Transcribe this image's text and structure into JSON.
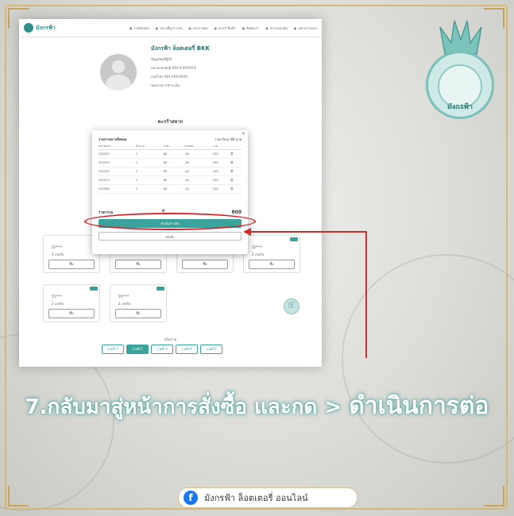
{
  "app": {
    "brand_name": "มังกรฟ้า",
    "logo_name": "มังกรฟ้า"
  },
  "nav": {
    "links": [
      "งวดปัจจุบัน",
      "สลากที่ถูกรางวัล",
      "ประกาศผล",
      "ตะกร้าสินค้า",
      "ติดต่อเรา",
      "สลากของฉัน",
      "ออกจากระบบ"
    ]
  },
  "profile": {
    "title": "มังกรฟ้า ล็อตเตอรี่ BKK",
    "lines": [
      "ข้อมูลบัญชีผู้ใช้",
      "หมายเลขบัญชี XXX-X-XXXXX-X",
      "เบอร์โทร 083-XXX-XXXX",
      "ช่องทางการชำระเงิน"
    ]
  },
  "page": {
    "section_title": "ตะกร้าสลาก",
    "pager_title": "เลือกงวด"
  },
  "modal": {
    "header": "รายการสลากทั้งหมด",
    "price_text": "ราคาใบละ 80 บาท",
    "columns": [
      "หมายเลข",
      "จำนวน",
      "ราคา",
      "ส่วนลด",
      "รวม",
      ""
    ],
    "rows": [
      [
        "255070",
        "2",
        "80",
        "-40",
        "200",
        "🗑"
      ],
      [
        "524070",
        "2",
        "80",
        "-40",
        "200",
        "🗑"
      ],
      [
        "222222",
        "2",
        "80",
        "-40",
        "200",
        "🗑"
      ],
      [
        "412573",
        "1",
        "80",
        "-20",
        "100",
        "🗑"
      ],
      [
        "412344",
        "1",
        "80",
        "-20",
        "100",
        "🗑"
      ]
    ],
    "total_label": "ราคารวม",
    "total_qty": "8",
    "total_price": "800",
    "continue_label": "ดำเนินการต่อ",
    "cancel_label": "ยกเลิก",
    "close_label": "×"
  },
  "cards": [
    {
      "n1": "55****",
      "n2": "2 งวดใบ",
      "btn": "ซื้อ"
    },
    {
      "n1": "",
      "n2": "",
      "btn": "ซื้อ"
    },
    {
      "n1": "",
      "n2": "",
      "btn": "ซื้อ"
    },
    {
      "n1": "55****",
      "n2": "2 งวดใบ",
      "btn": "ซื้อ"
    },
    {
      "n1": "55****",
      "n2": "2 งวดใบ",
      "btn": "ซื้อ"
    },
    {
      "n1": "55****",
      "n2": "2 งวดใบ",
      "btn": "ซื้อ"
    }
  ],
  "pager": [
    "งวดที่ 1",
    "งวดที่ 2",
    "งวดที่ 3",
    "งวดที่ 4",
    "งวดที่ 5"
  ],
  "caption": {
    "prefix": "7.กลับมาสู่หน้าการสั่งซื้อ และกด > ",
    "highlight": "ดำเนินการต่อ"
  },
  "footer": {
    "text": "มังกรฟ้า ล็อตเตอรี่ ออนไลน์",
    "fb_glyph": "f"
  },
  "colors": {
    "accent": "#3aa39b",
    "highlight_red": "#d3232a",
    "frame_gold": "#d8b77a"
  }
}
